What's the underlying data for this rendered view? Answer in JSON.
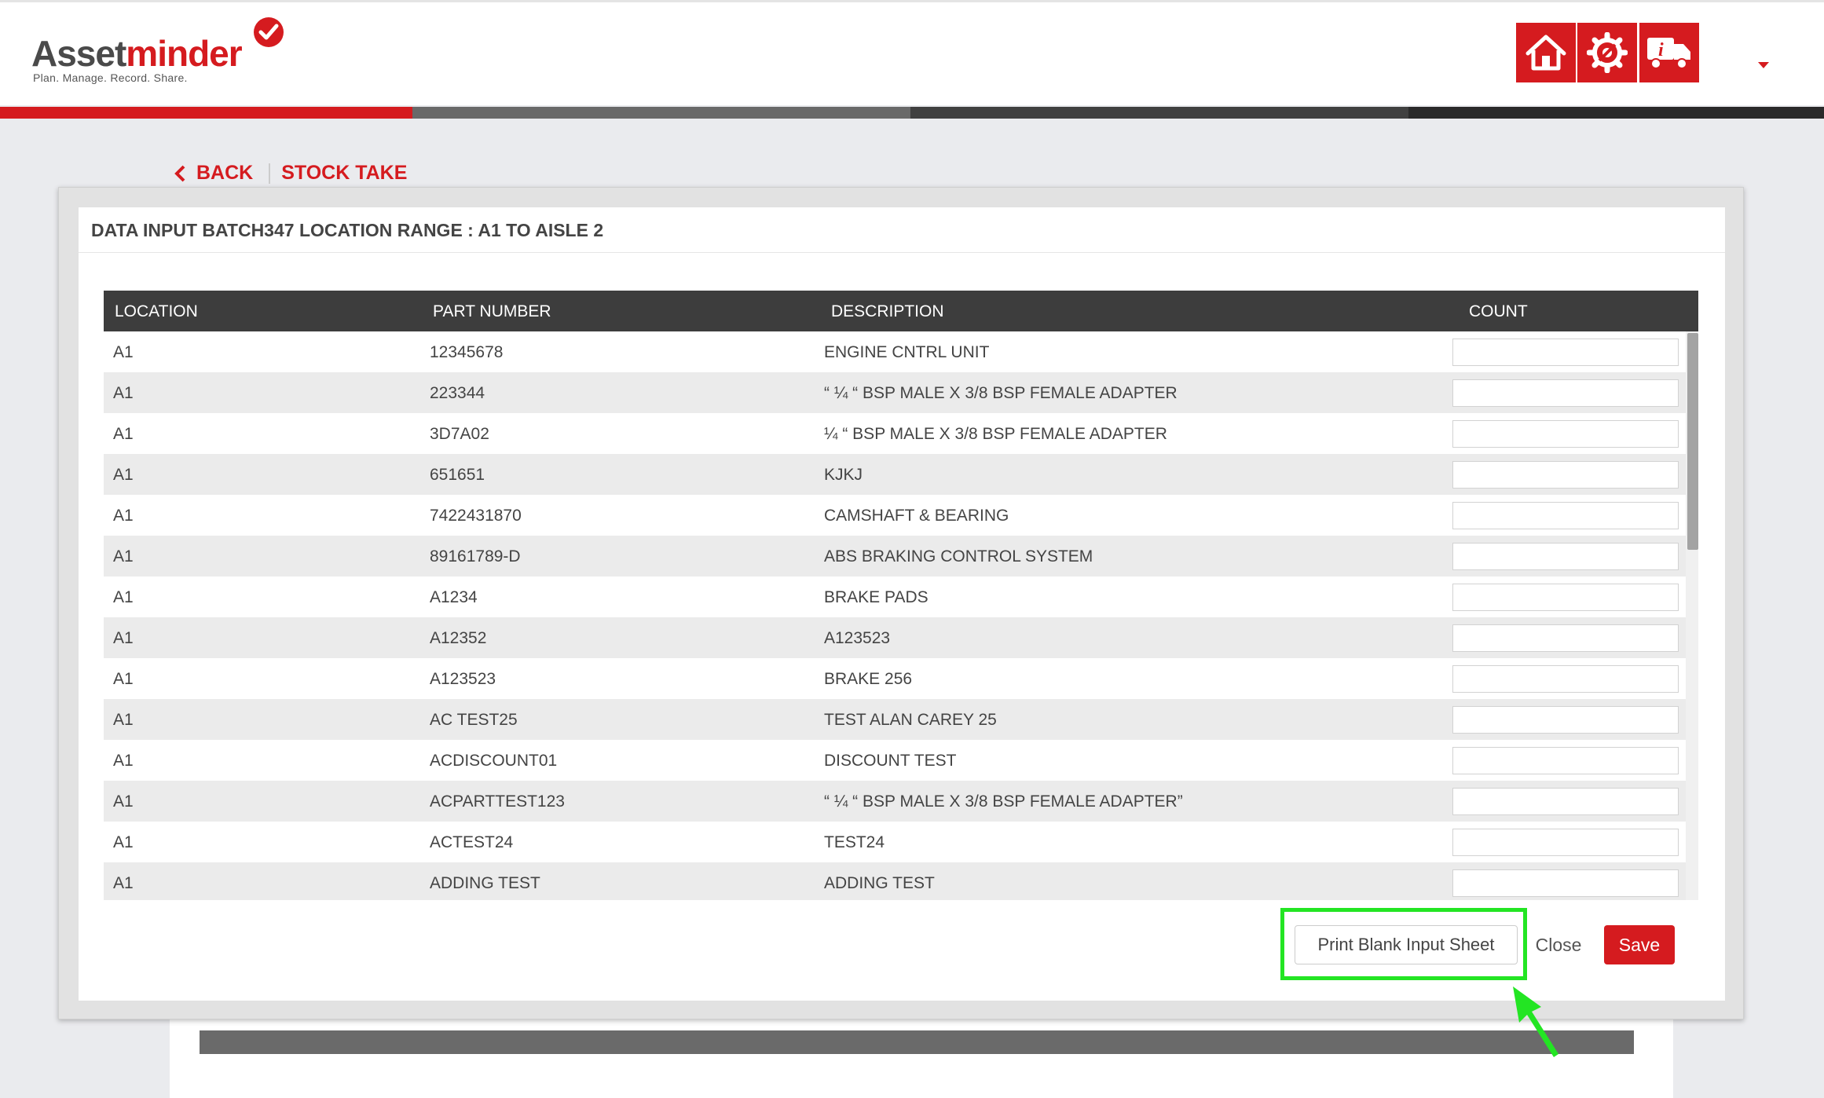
{
  "brand": {
    "name_part1": "Asset",
    "name_part2": "minder",
    "tagline": "Plan. Manage. Record. Share.",
    "accent_color": "#d51b1f"
  },
  "header": {
    "nav_icons": [
      "home-icon",
      "settings-gear-icon",
      "delivery-truck-info-icon"
    ],
    "dropdown_icon": "caret-down-icon"
  },
  "breadcrumb": {
    "back_label": "BACK",
    "title": "STOCK TAKE"
  },
  "modal": {
    "title": "DATA INPUT BATCH347 LOCATION RANGE : A1 TO AISLE 2",
    "table": {
      "headers": [
        "LOCATION",
        "PART NUMBER",
        "DESCRIPTION",
        "COUNT"
      ],
      "rows": [
        {
          "location": "A1",
          "part_number": "12345678",
          "description": "ENGINE CNTRL UNIT",
          "count": ""
        },
        {
          "location": "A1",
          "part_number": "223344",
          "description": "“ ¼ “ BSP MALE X 3/8 BSP FEMALE ADAPTER",
          "count": ""
        },
        {
          "location": "A1",
          "part_number": "3D7A02",
          "description": "¼ “ BSP MALE X 3/8 BSP FEMALE ADAPTER",
          "count": ""
        },
        {
          "location": "A1",
          "part_number": "651651",
          "description": "KJKJ",
          "count": ""
        },
        {
          "location": "A1",
          "part_number": "7422431870",
          "description": "CAMSHAFT & BEARING",
          "count": ""
        },
        {
          "location": "A1",
          "part_number": "89161789-D",
          "description": "ABS BRAKING CONTROL SYSTEM",
          "count": ""
        },
        {
          "location": "A1",
          "part_number": "A1234",
          "description": "BRAKE PADS",
          "count": ""
        },
        {
          "location": "A1",
          "part_number": "A12352",
          "description": "A123523",
          "count": ""
        },
        {
          "location": "A1",
          "part_number": "A123523",
          "description": "BRAKE 256",
          "count": ""
        },
        {
          "location": "A1",
          "part_number": "AC TEST25",
          "description": "TEST ALAN CAREY 25",
          "count": ""
        },
        {
          "location": "A1",
          "part_number": "ACDISCOUNT01",
          "description": "DISCOUNT TEST",
          "count": ""
        },
        {
          "location": "A1",
          "part_number": "ACPARTTEST123",
          "description": "“ ¼ “ BSP MALE X 3/8 BSP FEMALE ADAPTER”",
          "count": ""
        },
        {
          "location": "A1",
          "part_number": "ACTEST24",
          "description": "TEST24",
          "count": ""
        },
        {
          "location": "A1",
          "part_number": "ADDING TEST",
          "description": "ADDING TEST",
          "count": ""
        }
      ]
    },
    "buttons": {
      "print_label": "Print Blank Input Sheet",
      "close_label": "Close",
      "save_label": "Save"
    }
  },
  "annotation": {
    "highlight_color": "#23e523"
  }
}
